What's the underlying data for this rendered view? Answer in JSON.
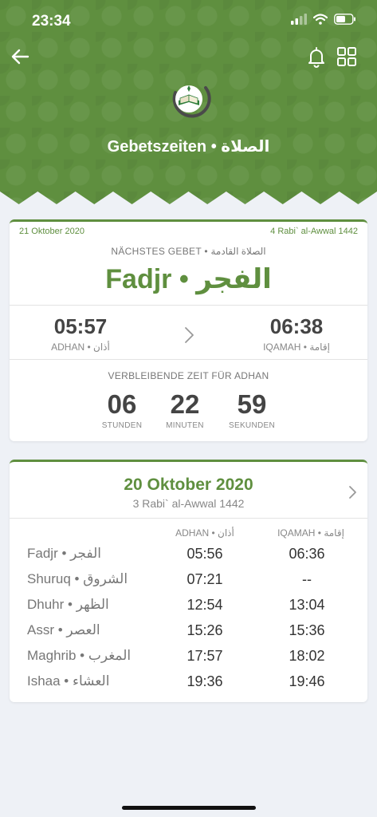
{
  "status": {
    "time": "23:34"
  },
  "header": {
    "title": "Gebetszeiten • الصلاة"
  },
  "next_prayer": {
    "gregorian_date": "21 Oktober 2020",
    "hijri_date": "4 Rabi` al-Awwal 1442",
    "label": "NÄCHSTES GEBET • الصلاة القادمة",
    "name": "Fadjr • الفجر",
    "adhan_time": "05:57",
    "adhan_label": "ADHAN • أذان",
    "iqamah_time": "06:38",
    "iqamah_label": "IQAMAH • إقامة",
    "remaining_label": "VERBLEIBENDE ZEIT FÜR ADHAN",
    "countdown": [
      {
        "value": "06",
        "unit": "STUNDEN"
      },
      {
        "value": "22",
        "unit": "MINUTEN"
      },
      {
        "value": "59",
        "unit": "SEKUNDEN"
      }
    ]
  },
  "schedule": {
    "date": "20 Oktober 2020",
    "hijri_date": "3 Rabi` al-Awwal 1442",
    "adhan_header": "ADHAN • أذان",
    "iqamah_header": "IQAMAH • إقامة",
    "rows": [
      {
        "name": "Fadjr • الفجر",
        "adhan": "05:56",
        "iqamah": "06:36"
      },
      {
        "name": "Shuruq • الشروق",
        "adhan": "07:21",
        "iqamah": "--"
      },
      {
        "name": "Dhuhr • الظهر",
        "adhan": "12:54",
        "iqamah": "13:04"
      },
      {
        "name": "Assr • العصر",
        "adhan": "15:26",
        "iqamah": "15:36"
      },
      {
        "name": "Maghrib • المغرب",
        "adhan": "17:57",
        "iqamah": "18:02"
      },
      {
        "name": "Ishaa • العشاء",
        "adhan": "19:36",
        "iqamah": "19:46"
      }
    ]
  },
  "colors": {
    "accent": "#5f8f3f",
    "background": "#eef1f6"
  },
  "icons": [
    "back-arrow-icon",
    "bell-icon",
    "grid-icon",
    "quran-logo-icon",
    "chevron-right-icon"
  ]
}
